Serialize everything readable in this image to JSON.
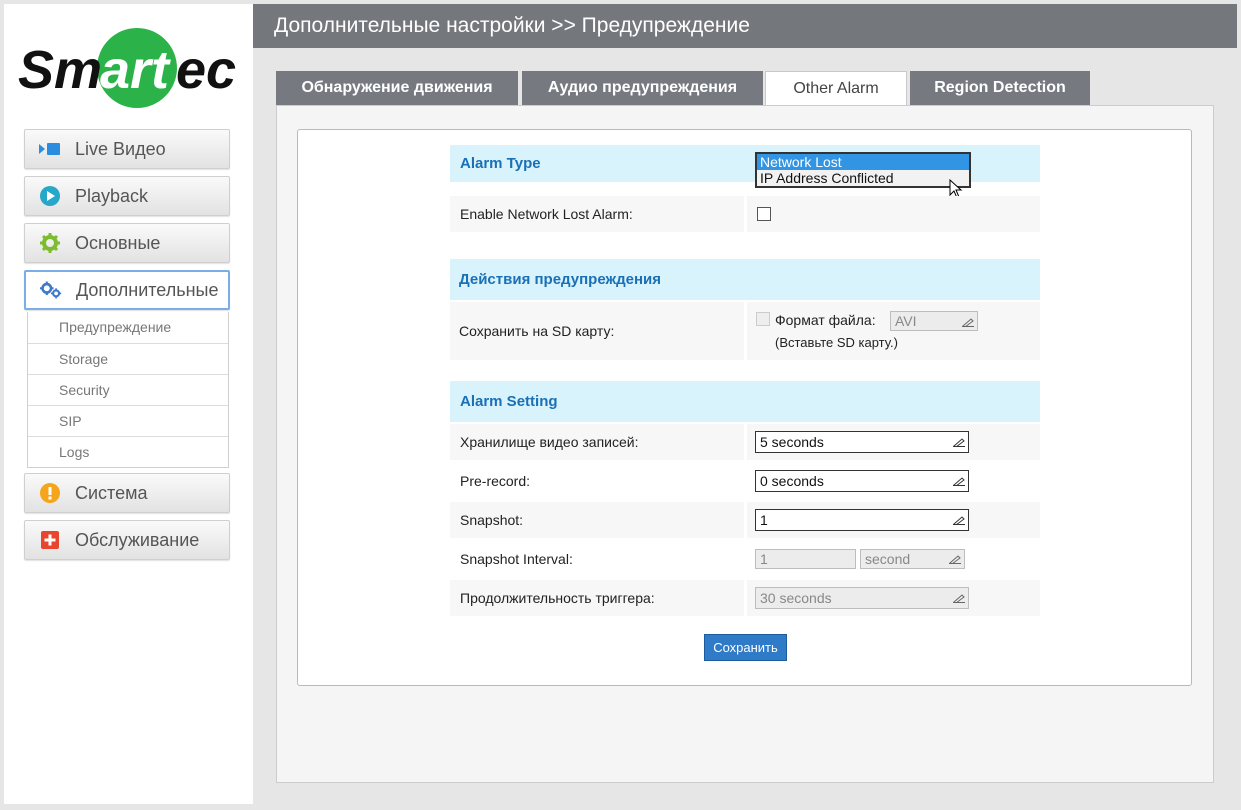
{
  "brand": {
    "logo_text_1": "Sm",
    "logo_text_2": "art",
    "logo_text_3": "ec"
  },
  "sidebar": {
    "items": [
      {
        "label": "Live Видео",
        "icon": "video-icon",
        "color": "#2b8de0"
      },
      {
        "label": "Playback",
        "icon": "play-icon",
        "color": "#27a7c9"
      },
      {
        "label": "Основные",
        "icon": "gear-icon",
        "color": "#7cbc2e"
      },
      {
        "label": "Дополнительные",
        "icon": "gears-icon",
        "color": "#3b79cc"
      },
      {
        "label": "Система",
        "icon": "warning-icon",
        "color": "#f4a51c"
      },
      {
        "label": "Обслуживание",
        "icon": "plus-icon",
        "color": "#e8442e"
      }
    ],
    "submenu": [
      "Предупреждение",
      "Storage",
      "Security",
      "SIP",
      "Logs"
    ]
  },
  "header": {
    "title": "Дополнительные настройки >> Предупреждение"
  },
  "tabs": [
    {
      "label": "Обнаружение движения"
    },
    {
      "label": "Аудио предупреждения"
    },
    {
      "label": "Other Alarm"
    },
    {
      "label": "Region Detection"
    }
  ],
  "form": {
    "alarm_type_label": "Alarm Type",
    "alarm_type_options": [
      "Network Lost",
      "IP Address Conflicted"
    ],
    "enable_label": "Enable Network Lost Alarm:",
    "actions_section": "Действия предупреждения",
    "sd_label": "Сохранить на SD карту:",
    "file_format_label": "Формат файла:",
    "file_format_value": "AVI",
    "sd_hint": "(Вставьте SD карту.)",
    "alarm_setting_section": "Alarm Setting",
    "storage_label": "Хранилище видео записей:",
    "storage_value": "5 seconds",
    "prerecord_label": "Pre-record:",
    "prerecord_value": "0 seconds",
    "snapshot_label": "Snapshot:",
    "snapshot_value": "1",
    "interval_label": "Snapshot Interval:",
    "interval_value": "1",
    "interval_unit": "second",
    "trigger_label": "Продолжительность триггера:",
    "trigger_value": "30 seconds",
    "save_label": "Сохранить"
  }
}
